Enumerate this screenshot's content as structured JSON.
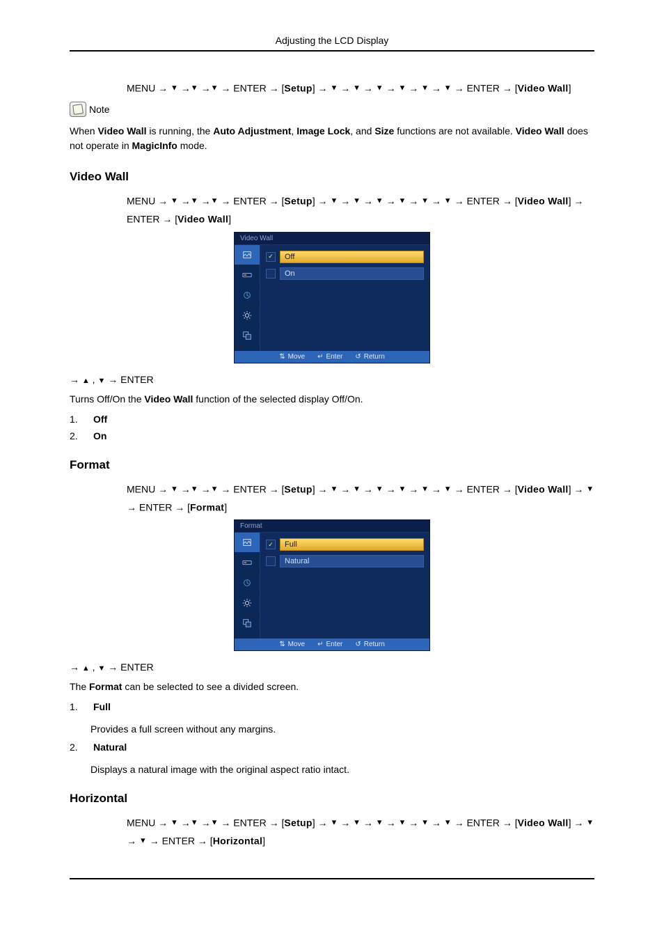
{
  "header": {
    "title": "Adjusting the LCD Display"
  },
  "intro_path": {
    "menu": "MENU",
    "enter": "ENTER",
    "setup": "Setup",
    "final": "Video Wall"
  },
  "note": {
    "label": "Note",
    "text_before": "When ",
    "vw": "Video Wall",
    "text_mid1": " is running, the ",
    "aa": "Auto Adjustment",
    "sep1": ", ",
    "il": "Image Lock",
    "sep2": ", and ",
    "sz": "Size",
    "text_mid2": " functions are not available. ",
    "vw2": "Video Wall",
    "text_mid3": " does not operate in ",
    "mi": "MagicInfo",
    "text_end": " mode."
  },
  "section_video_wall": {
    "heading": "Video Wall",
    "path_menu": "MENU",
    "path_enter": "ENTER",
    "path_setup": "Setup",
    "path_vw": "Video Wall",
    "osd_title": "Video Wall",
    "opt_off": "Off",
    "opt_on": "On",
    "small_nav_enter": "ENTER",
    "desc_pre": "Turns Off/On the ",
    "desc_bold": "Video Wall",
    "desc_post": " function of the selected display Off/On.",
    "list": [
      {
        "num": "1.",
        "label": "Off"
      },
      {
        "num": "2.",
        "label": "On"
      }
    ]
  },
  "section_format": {
    "heading": "Format",
    "path_menu": "MENU",
    "path_enter": "ENTER",
    "path_setup": "Setup",
    "path_vw": "Video Wall",
    "path_format": "Format",
    "osd_title": "Format",
    "opt_full": "Full",
    "opt_natural": "Natural",
    "small_nav_enter": "ENTER",
    "desc_pre": "The ",
    "desc_bold": "Format",
    "desc_post": " can be selected to see a divided screen.",
    "list": [
      {
        "num": "1.",
        "label": "Full",
        "desc": "Provides a full screen without any margins."
      },
      {
        "num": "2.",
        "label": "Natural",
        "desc": "Displays a natural image with the original aspect ratio intact."
      }
    ]
  },
  "section_horizontal": {
    "heading": "Horizontal",
    "path_menu": "MENU",
    "path_enter": "ENTER",
    "path_setup": "Setup",
    "path_vw": "Video Wall",
    "path_horizontal": "Horizontal"
  },
  "osd_footer": {
    "move": "Move",
    "enter": "Enter",
    "return": "Return"
  }
}
